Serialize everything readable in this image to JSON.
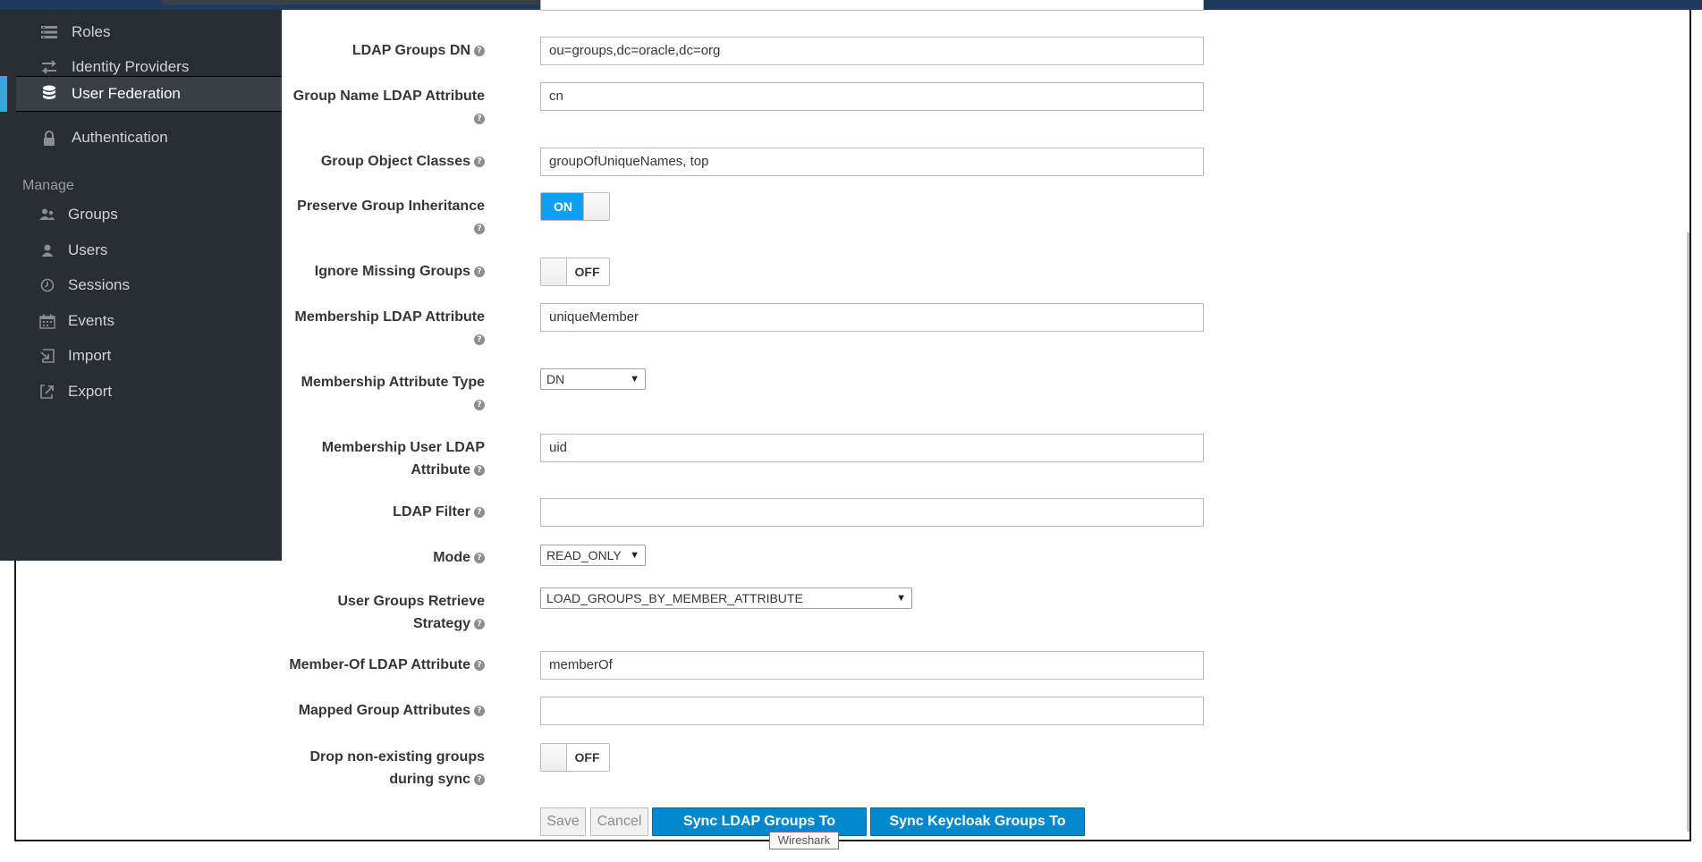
{
  "sidebar": {
    "items": [
      {
        "label": "Roles",
        "icon": "list-icon"
      },
      {
        "label": "Identity Providers",
        "icon": "exchange-icon"
      },
      {
        "label": "User Federation",
        "icon": "database-icon"
      },
      {
        "label": "Authentication",
        "icon": "lock-icon"
      }
    ],
    "section_label": "Manage",
    "manage_items": [
      {
        "label": "Groups",
        "icon": "users-icon"
      },
      {
        "label": "Users",
        "icon": "user-icon"
      },
      {
        "label": "Sessions",
        "icon": "clock-icon"
      },
      {
        "label": "Events",
        "icon": "calendar-icon"
      },
      {
        "label": "Import",
        "icon": "import-icon"
      },
      {
        "label": "Export",
        "icon": "export-icon"
      }
    ]
  },
  "form": {
    "ldap_groups_dn": {
      "label": "LDAP Groups DN",
      "value": "ou=groups,dc=oracle,dc=org"
    },
    "group_name_attr": {
      "label": "Group Name LDAP Attribute",
      "value": "cn"
    },
    "group_object_classes": {
      "label": "Group Object Classes",
      "value": "groupOfUniqueNames, top"
    },
    "preserve_inheritance": {
      "label": "Preserve Group Inheritance",
      "state": "ON"
    },
    "ignore_missing": {
      "label": "Ignore Missing Groups",
      "state": "OFF"
    },
    "membership_attr": {
      "label": "Membership LDAP Attribute",
      "value": "uniqueMember"
    },
    "membership_type": {
      "label": "Membership Attribute Type",
      "value": "DN"
    },
    "membership_user_attr": {
      "label_line1": "Membership User LDAP",
      "label_line2": "Attribute",
      "value": "uid"
    },
    "ldap_filter": {
      "label": "LDAP Filter",
      "value": ""
    },
    "mode": {
      "label": "Mode",
      "value": "READ_ONLY"
    },
    "retrieve_strategy": {
      "label_line1": "User Groups Retrieve",
      "label_line2": "Strategy",
      "value": "LOAD_GROUPS_BY_MEMBER_ATTRIBUTE"
    },
    "member_of_attr": {
      "label": "Member-Of LDAP Attribute",
      "value": "memberOf"
    },
    "mapped_group_attrs": {
      "label": "Mapped Group Attributes",
      "value": ""
    },
    "drop_non_existing": {
      "label_line1": "Drop non-existing groups",
      "label_line2": "during sync",
      "state": "OFF"
    }
  },
  "buttons": {
    "save": "Save",
    "cancel": "Cancel",
    "sync_to_keycloak": "Sync LDAP Groups To Keycloak",
    "sync_to_ldap": "Sync Keycloak Groups To LDAP"
  },
  "tooltip": "Wireshark",
  "help_glyph": "?",
  "colors": {
    "sidebar_bg": "#292e34",
    "active_accent": "#39a5dc",
    "primary_button": "#0088ce",
    "toggle_on": "#0d9ff0"
  }
}
